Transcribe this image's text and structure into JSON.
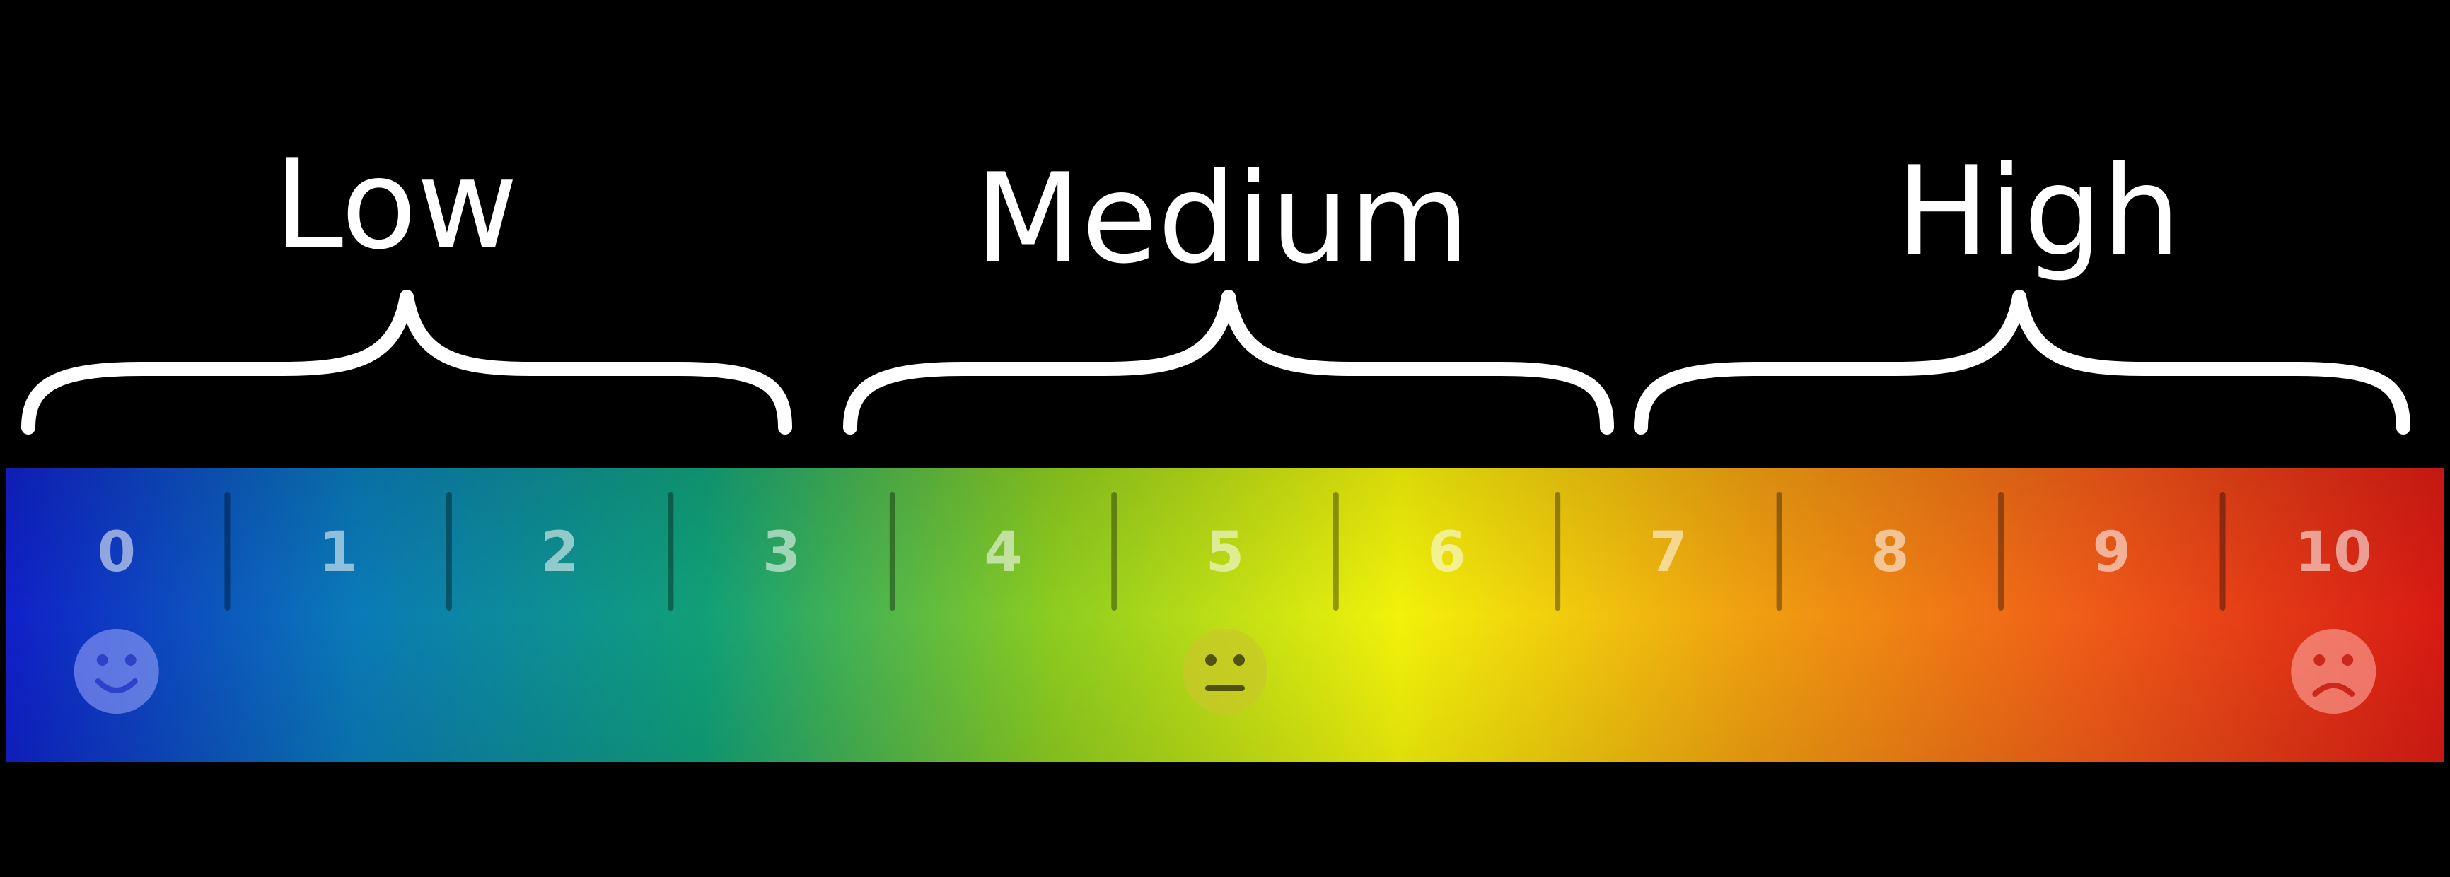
{
  "groups": [
    {
      "label": "Low"
    },
    {
      "label": "Medium"
    },
    {
      "label": "High"
    }
  ],
  "scale": {
    "numbers": [
      "0",
      "1",
      "2",
      "3",
      "4",
      "5",
      "6",
      "7",
      "8",
      "9",
      "10"
    ],
    "gradient_colors": [
      "#1020c8",
      "#0a7ab8",
      "#10a078",
      "#8ccc20",
      "#f2f20a",
      "#f0a010",
      "#f05a18",
      "#d81a14"
    ]
  },
  "faces": [
    {
      "name": "happy-face-icon",
      "at_value": 0
    },
    {
      "name": "neutral-face-icon",
      "at_value": 5
    },
    {
      "name": "sad-face-icon",
      "at_value": 10
    }
  ]
}
